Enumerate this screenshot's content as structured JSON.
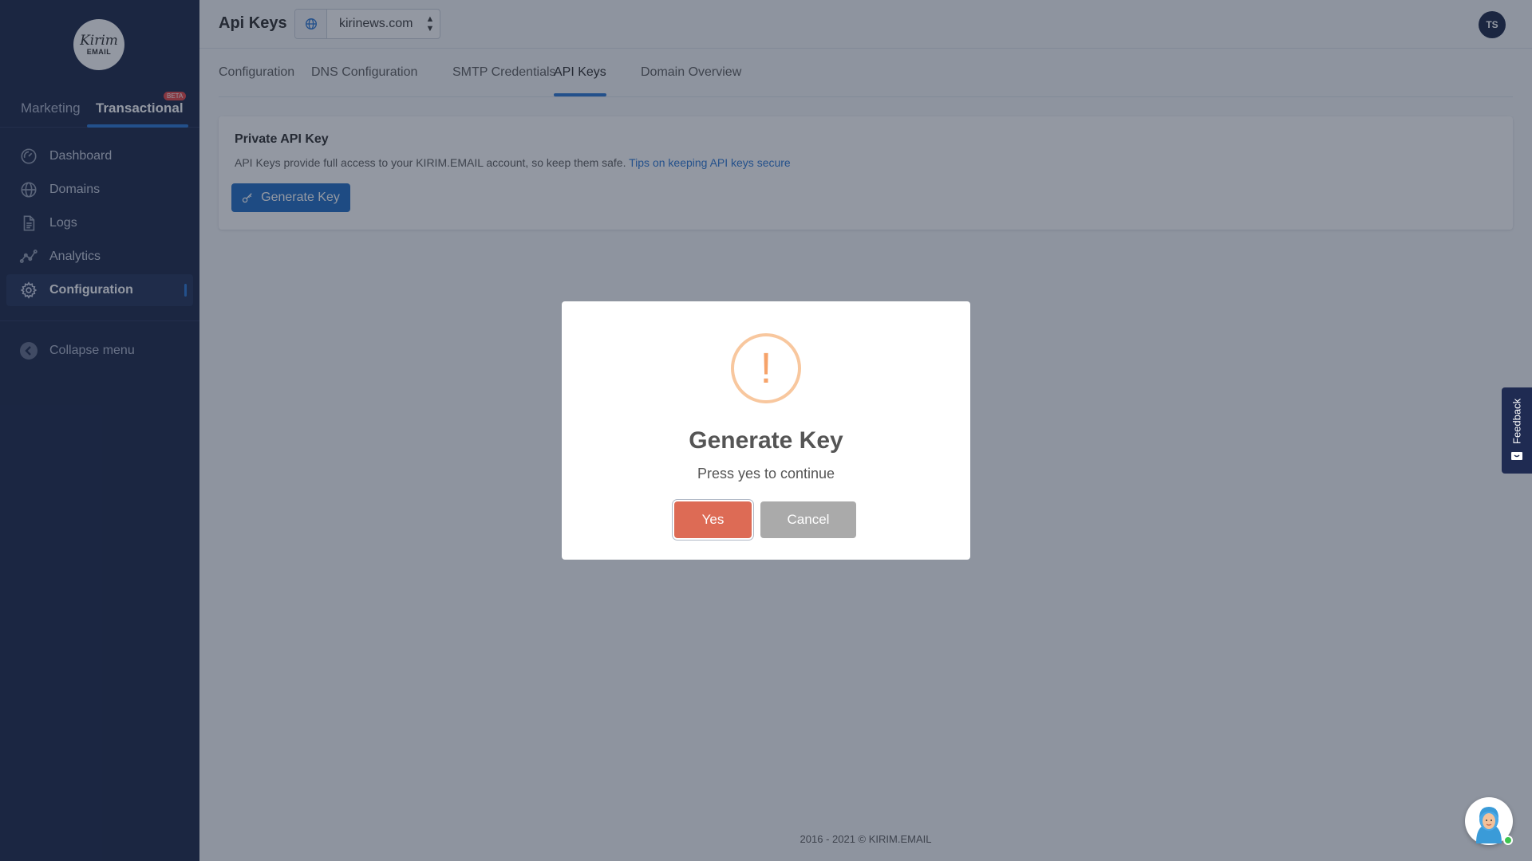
{
  "sidebar": {
    "logo": {
      "line1": "Kirim",
      "line2": "EMAIL"
    },
    "mode_tabs": {
      "marketing": "Marketing",
      "transactional": "Transactional",
      "badge": "BETA"
    },
    "items": [
      {
        "label": "Dashboard",
        "icon": "dashboard-icon"
      },
      {
        "label": "Domains",
        "icon": "globe-icon"
      },
      {
        "label": "Logs",
        "icon": "document-icon"
      },
      {
        "label": "Analytics",
        "icon": "analytics-icon"
      },
      {
        "label": "Configuration",
        "icon": "gear-icon"
      }
    ],
    "collapse_label": "Collapse menu"
  },
  "header": {
    "title": "Api Keys",
    "domain_value": "kirinews.com",
    "avatar_initials": "TS"
  },
  "tabs": [
    {
      "label": "Configuration"
    },
    {
      "label": "DNS Configuration"
    },
    {
      "label": "SMTP Credentials"
    },
    {
      "label": "API Keys"
    },
    {
      "label": "Domain Overview"
    }
  ],
  "card": {
    "title": "Private API Key",
    "description": "API Keys provide full access to your KIRIM.EMAIL account, so keep them safe.",
    "link": "Tips on keeping API keys secure",
    "button": "Generate Key"
  },
  "footer": "2016 - 2021 © KIRIM.EMAIL",
  "feedback_label": "Feedback",
  "modal": {
    "icon_text": "!",
    "title": "Generate Key",
    "text": "Press yes to continue",
    "yes": "Yes",
    "cancel": "Cancel"
  },
  "colors": {
    "sidebar_bg": "#0e1a3d",
    "accent": "#1f6fd1",
    "confirm": "#dd6b55",
    "warning": "#f6a36a"
  }
}
